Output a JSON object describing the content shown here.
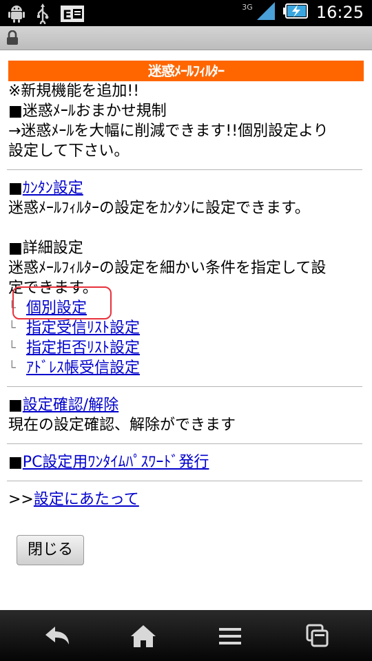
{
  "statusbar": {
    "network": "3G",
    "time": "16:25",
    "icons": [
      "android-icon",
      "usb-icon",
      "email-notice-icon",
      "signal-icon",
      "battery-charging-icon"
    ]
  },
  "lockbar": {
    "icon": "lock-icon"
  },
  "page": {
    "header_title": "迷惑ﾒｰﾙﾌｨﾙﾀｰ",
    "notice_line1": "※新規機能を追加!!",
    "notice_line2": "■迷惑ﾒｰﾙおまかせ規制",
    "notice_line3": "→迷惑ﾒｰﾙを大幅に削減できます!!個別設定より",
    "notice_line4": "設定して下さい。",
    "easy_square": "■",
    "easy_link": "ｶﾝﾀﾝ設定",
    "easy_desc": "迷惑ﾒｰﾙﾌｨﾙﾀｰの設定をｶﾝﾀﾝに設定できます。",
    "detail_title": "■詳細設定",
    "detail_desc1": "迷惑ﾒｰﾙﾌｨﾙﾀｰの設定を細かい条件を指定して設",
    "detail_desc2": "定できます。",
    "sub_links": [
      "個別設定",
      "指定受信ﾘｽﾄ設定",
      "指定拒否ﾘｽﾄ設定",
      "ｱﾄﾞﾚｽ帳受信設定"
    ],
    "sub_corner": "└",
    "confirm_square": "■",
    "confirm_link": "設定確認/解除",
    "confirm_desc": "現在の設定確認、解除ができます",
    "pc_square": "■",
    "pc_link": "PC設定用ﾜﾝﾀｲﾑﾊﾟｽﾜｰﾄﾞ発行",
    "about_prefix": ">>",
    "about_link": "設定にあたって",
    "close_label": "閉じる"
  },
  "navbar": {
    "icons": [
      "back-icon",
      "home-icon",
      "menu-icon",
      "recent-apps-icon"
    ]
  },
  "colors": {
    "header_bg": "#ff6600",
    "link": "#0000cc",
    "highlight": "#e8303a"
  }
}
